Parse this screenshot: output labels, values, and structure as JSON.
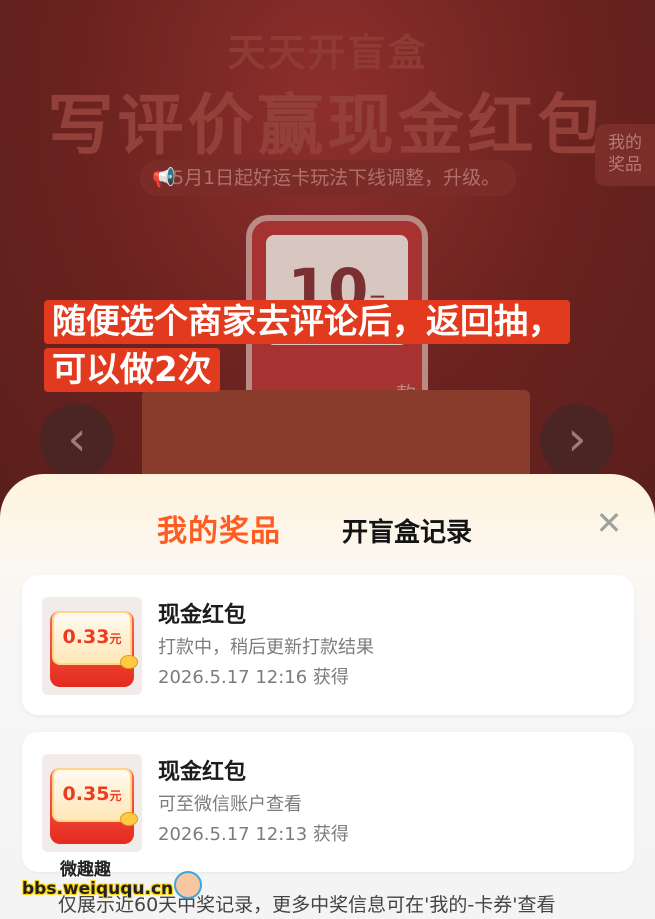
{
  "background": {
    "title_small": "天天开盲盒",
    "title_big": "写评价赢现金红包",
    "notice": "5月1日起好运卡玩法下线调整，升级。",
    "side_button": "我的\n奖品",
    "card_amount": "10",
    "card_unit": "元",
    "card_suffix": "款"
  },
  "caption": "随便选个商家去评论后，返回抽，可以做2次",
  "sheet": {
    "tab_mine": "我的奖品",
    "tab_record": "开盲盒记录",
    "prizes": [
      {
        "amount": "0.33",
        "unit": "元",
        "title": "现金红包",
        "status": "打款中，稍后更新打款结果",
        "time": "2026.5.17 12:16 获得"
      },
      {
        "amount": "0.35",
        "unit": "元",
        "title": "现金红包",
        "status": "可至微信账户查看",
        "time": "2026.5.17 12:13 获得"
      }
    ],
    "footer_note": "仅展示近60天中奖记录，更多中奖信息可在'我的-卡券'查看"
  },
  "watermark": {
    "top": "微趣趣",
    "bottom": "bbs.weiququ.cn"
  },
  "colors": {
    "accent": "#ff5c21",
    "caption_bg": "#e23a1e",
    "envelope_red": "#e32a1f"
  },
  "icons": [
    "speaker-icon",
    "chevron-left-icon",
    "chevron-right-icon",
    "close-icon"
  ]
}
